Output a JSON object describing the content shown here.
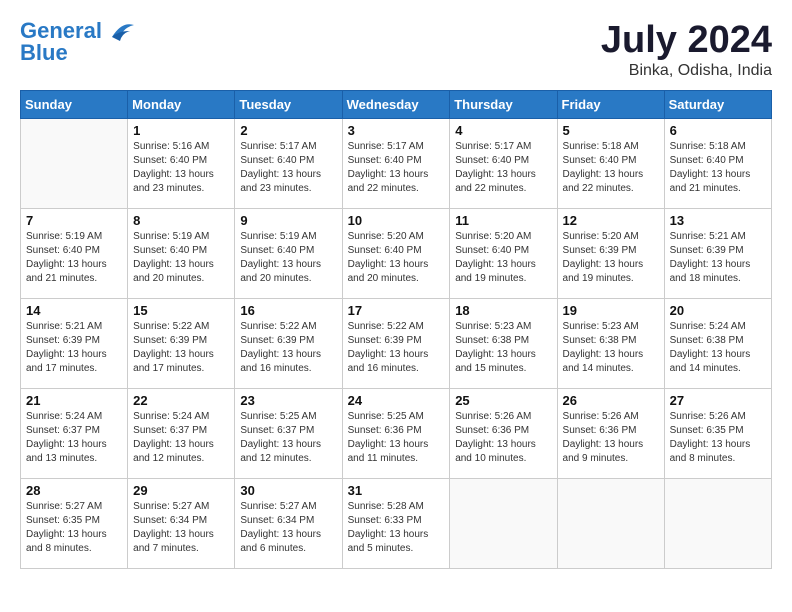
{
  "header": {
    "logo_line1": "General",
    "logo_line2": "Blue",
    "month": "July 2024",
    "location": "Binka, Odisha, India"
  },
  "weekdays": [
    "Sunday",
    "Monday",
    "Tuesday",
    "Wednesday",
    "Thursday",
    "Friday",
    "Saturday"
  ],
  "weeks": [
    [
      {
        "day": "",
        "sunrise": "",
        "sunset": "",
        "daylight": ""
      },
      {
        "day": "1",
        "sunrise": "5:16 AM",
        "sunset": "6:40 PM",
        "daylight": "13 hours and 23 minutes."
      },
      {
        "day": "2",
        "sunrise": "5:17 AM",
        "sunset": "6:40 PM",
        "daylight": "13 hours and 23 minutes."
      },
      {
        "day": "3",
        "sunrise": "5:17 AM",
        "sunset": "6:40 PM",
        "daylight": "13 hours and 22 minutes."
      },
      {
        "day": "4",
        "sunrise": "5:17 AM",
        "sunset": "6:40 PM",
        "daylight": "13 hours and 22 minutes."
      },
      {
        "day": "5",
        "sunrise": "5:18 AM",
        "sunset": "6:40 PM",
        "daylight": "13 hours and 22 minutes."
      },
      {
        "day": "6",
        "sunrise": "5:18 AM",
        "sunset": "6:40 PM",
        "daylight": "13 hours and 21 minutes."
      }
    ],
    [
      {
        "day": "7",
        "sunrise": "5:19 AM",
        "sunset": "6:40 PM",
        "daylight": "13 hours and 21 minutes."
      },
      {
        "day": "8",
        "sunrise": "5:19 AM",
        "sunset": "6:40 PM",
        "daylight": "13 hours and 20 minutes."
      },
      {
        "day": "9",
        "sunrise": "5:19 AM",
        "sunset": "6:40 PM",
        "daylight": "13 hours and 20 minutes."
      },
      {
        "day": "10",
        "sunrise": "5:20 AM",
        "sunset": "6:40 PM",
        "daylight": "13 hours and 20 minutes."
      },
      {
        "day": "11",
        "sunrise": "5:20 AM",
        "sunset": "6:40 PM",
        "daylight": "13 hours and 19 minutes."
      },
      {
        "day": "12",
        "sunrise": "5:20 AM",
        "sunset": "6:39 PM",
        "daylight": "13 hours and 19 minutes."
      },
      {
        "day": "13",
        "sunrise": "5:21 AM",
        "sunset": "6:39 PM",
        "daylight": "13 hours and 18 minutes."
      }
    ],
    [
      {
        "day": "14",
        "sunrise": "5:21 AM",
        "sunset": "6:39 PM",
        "daylight": "13 hours and 17 minutes."
      },
      {
        "day": "15",
        "sunrise": "5:22 AM",
        "sunset": "6:39 PM",
        "daylight": "13 hours and 17 minutes."
      },
      {
        "day": "16",
        "sunrise": "5:22 AM",
        "sunset": "6:39 PM",
        "daylight": "13 hours and 16 minutes."
      },
      {
        "day": "17",
        "sunrise": "5:22 AM",
        "sunset": "6:39 PM",
        "daylight": "13 hours and 16 minutes."
      },
      {
        "day": "18",
        "sunrise": "5:23 AM",
        "sunset": "6:38 PM",
        "daylight": "13 hours and 15 minutes."
      },
      {
        "day": "19",
        "sunrise": "5:23 AM",
        "sunset": "6:38 PM",
        "daylight": "13 hours and 14 minutes."
      },
      {
        "day": "20",
        "sunrise": "5:24 AM",
        "sunset": "6:38 PM",
        "daylight": "13 hours and 14 minutes."
      }
    ],
    [
      {
        "day": "21",
        "sunrise": "5:24 AM",
        "sunset": "6:37 PM",
        "daylight": "13 hours and 13 minutes."
      },
      {
        "day": "22",
        "sunrise": "5:24 AM",
        "sunset": "6:37 PM",
        "daylight": "13 hours and 12 minutes."
      },
      {
        "day": "23",
        "sunrise": "5:25 AM",
        "sunset": "6:37 PM",
        "daylight": "13 hours and 12 minutes."
      },
      {
        "day": "24",
        "sunrise": "5:25 AM",
        "sunset": "6:36 PM",
        "daylight": "13 hours and 11 minutes."
      },
      {
        "day": "25",
        "sunrise": "5:26 AM",
        "sunset": "6:36 PM",
        "daylight": "13 hours and 10 minutes."
      },
      {
        "day": "26",
        "sunrise": "5:26 AM",
        "sunset": "6:36 PM",
        "daylight": "13 hours and 9 minutes."
      },
      {
        "day": "27",
        "sunrise": "5:26 AM",
        "sunset": "6:35 PM",
        "daylight": "13 hours and 8 minutes."
      }
    ],
    [
      {
        "day": "28",
        "sunrise": "5:27 AM",
        "sunset": "6:35 PM",
        "daylight": "13 hours and 8 minutes."
      },
      {
        "day": "29",
        "sunrise": "5:27 AM",
        "sunset": "6:34 PM",
        "daylight": "13 hours and 7 minutes."
      },
      {
        "day": "30",
        "sunrise": "5:27 AM",
        "sunset": "6:34 PM",
        "daylight": "13 hours and 6 minutes."
      },
      {
        "day": "31",
        "sunrise": "5:28 AM",
        "sunset": "6:33 PM",
        "daylight": "13 hours and 5 minutes."
      },
      {
        "day": "",
        "sunrise": "",
        "sunset": "",
        "daylight": ""
      },
      {
        "day": "",
        "sunrise": "",
        "sunset": "",
        "daylight": ""
      },
      {
        "day": "",
        "sunrise": "",
        "sunset": "",
        "daylight": ""
      }
    ]
  ]
}
